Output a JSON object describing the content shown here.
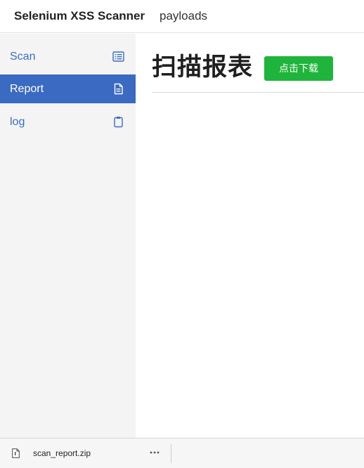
{
  "header": {
    "brand": "Selenium XSS Scanner",
    "nav_payloads": "payloads"
  },
  "sidebar": {
    "items": [
      {
        "label": "Scan",
        "icon": "list-icon",
        "active": false
      },
      {
        "label": "Report",
        "icon": "document-icon",
        "active": true
      },
      {
        "label": "log",
        "icon": "clipboard-icon",
        "active": false
      }
    ]
  },
  "main": {
    "title": "扫描报表",
    "download_label": "点击下载"
  },
  "download_shelf": {
    "file_name": "scan_report.zip",
    "file_icon": "file-icon",
    "more_icon": "more-icon"
  },
  "colors": {
    "accent": "#3a6ac1",
    "link": "#3b6cc4",
    "download_button": "#1fb53c",
    "sidebar_bg": "#f4f4f4"
  }
}
